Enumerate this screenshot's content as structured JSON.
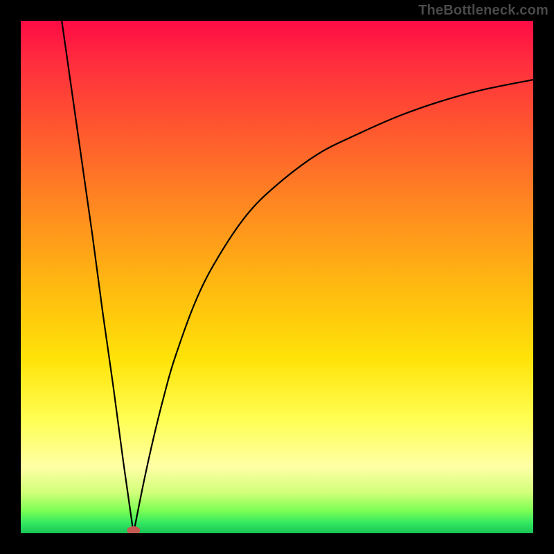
{
  "watermark": "TheBottleneck.com",
  "chart_data": {
    "type": "line",
    "title": "",
    "xlabel": "",
    "ylabel": "",
    "xlim": [
      0,
      100
    ],
    "ylim": [
      0,
      100
    ],
    "grid": false,
    "legend": false,
    "annotations": [
      {
        "kind": "marker",
        "x": 22,
        "y": 0,
        "shape": "pill",
        "color": "#c45a52"
      }
    ],
    "series": [
      {
        "name": "left-branch",
        "x": [
          8,
          10,
          12,
          14,
          16,
          18,
          20,
          21,
          22
        ],
        "values": [
          100,
          86,
          72,
          58,
          43,
          29,
          14,
          7,
          0
        ]
      },
      {
        "name": "right-branch",
        "x": [
          22,
          24,
          26,
          28,
          30,
          34,
          38,
          44,
          50,
          58,
          66,
          74,
          82,
          90,
          100
        ],
        "values": [
          0,
          10,
          19,
          27,
          34,
          45,
          53,
          62,
          68,
          74,
          78,
          81.5,
          84.3,
          86.5,
          88.5
        ]
      }
    ],
    "background_gradient_stops": [
      {
        "pos": 0.0,
        "color": "#ff0b44"
      },
      {
        "pos": 0.08,
        "color": "#ff2d3e"
      },
      {
        "pos": 0.22,
        "color": "#ff5a2e"
      },
      {
        "pos": 0.38,
        "color": "#ff8e1f"
      },
      {
        "pos": 0.52,
        "color": "#ffba10"
      },
      {
        "pos": 0.66,
        "color": "#ffe308"
      },
      {
        "pos": 0.78,
        "color": "#ffff55"
      },
      {
        "pos": 0.87,
        "color": "#ffffa5"
      },
      {
        "pos": 0.92,
        "color": "#d2ff7a"
      },
      {
        "pos": 0.955,
        "color": "#7fff55"
      },
      {
        "pos": 0.98,
        "color": "#33e860"
      },
      {
        "pos": 1.0,
        "color": "#17c455"
      }
    ]
  }
}
